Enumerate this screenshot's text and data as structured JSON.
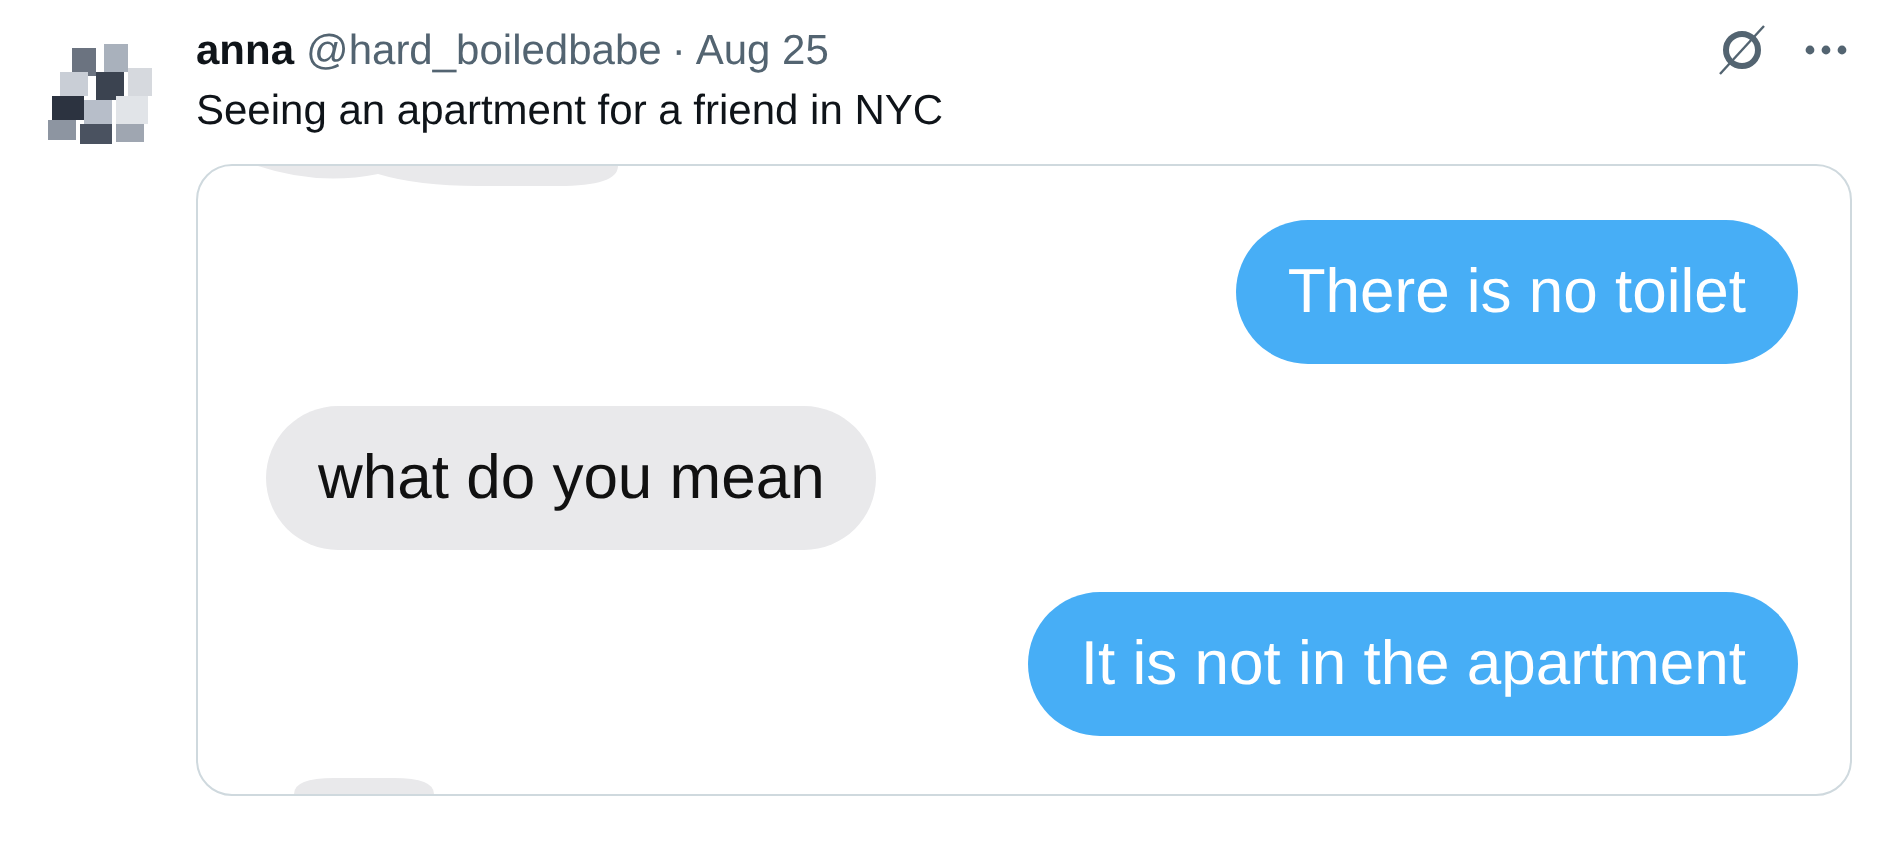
{
  "tweet": {
    "name": "anna",
    "handle": "@hard_boiledbabe",
    "separator": "·",
    "date": "Aug 25",
    "text": "Seeing an apartment for a friend in NYC"
  },
  "image": {
    "messages": [
      {
        "kind": "sent",
        "text": "There is no toilet"
      },
      {
        "kind": "received",
        "text": "what do you mean"
      },
      {
        "kind": "sent",
        "text": "It is not in the apartment"
      }
    ]
  }
}
